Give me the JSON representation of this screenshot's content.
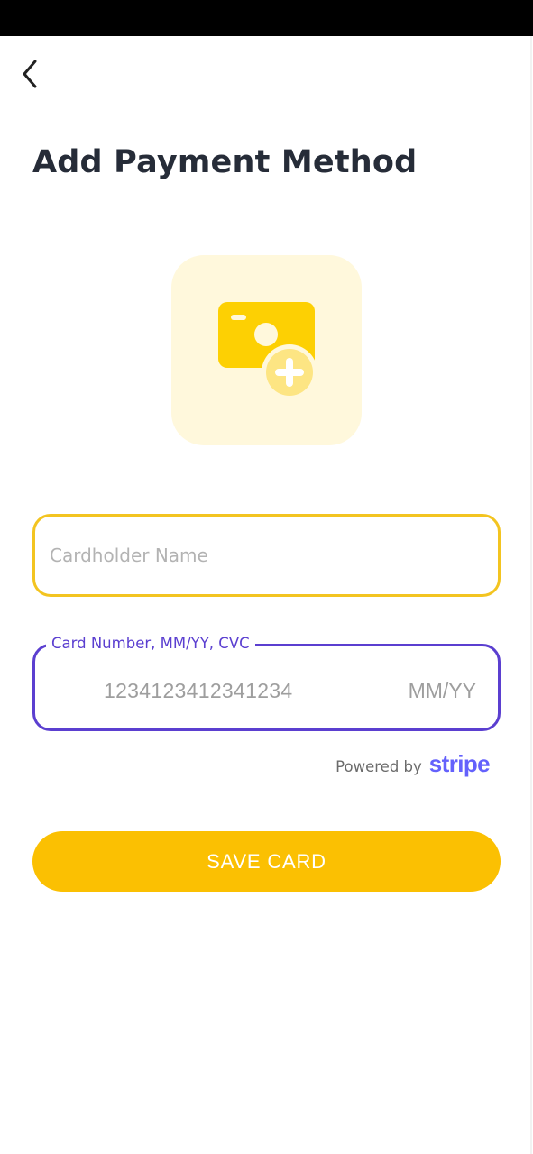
{
  "header": {
    "back_icon": "chevron-left-icon",
    "title": "Add Payment Method"
  },
  "hero": {
    "icon": "add-card-icon",
    "tile_color": "#fff8dc",
    "icon_color": "#fdd003",
    "badge_color": "#fde583"
  },
  "form": {
    "cardholder_placeholder": "Cardholder Name",
    "cardholder_value": "",
    "card_legend": "Card Number, MM/YY, CVC",
    "card_number_placeholder": "1234123412341234",
    "expiry_placeholder": "MM/YY"
  },
  "powered_by": {
    "label": "Powered by",
    "brand": "stripe"
  },
  "actions": {
    "save_label": "SAVE CARD"
  },
  "colors": {
    "accent_yellow": "#fbc002",
    "name_border": "#f3c420",
    "card_border": "#5b3fd0",
    "stripe": "#6461fc",
    "title": "#262c38"
  }
}
